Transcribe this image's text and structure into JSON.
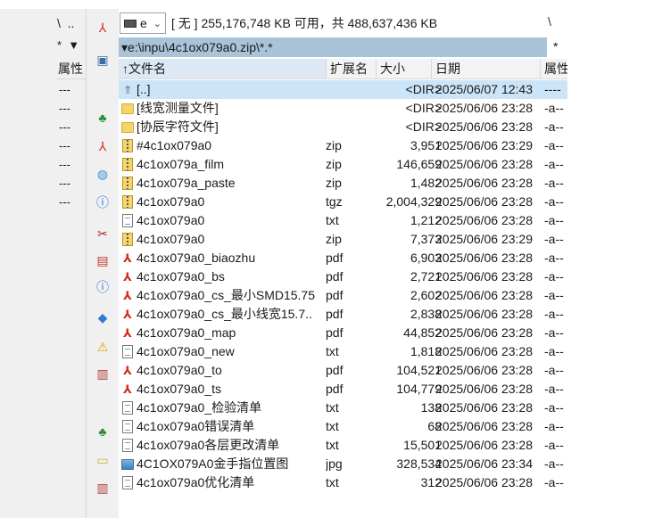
{
  "left_pane": {
    "toolbar_a": "\\  ..",
    "toolbar_b": "*  ▼",
    "header_attr": "属性",
    "rows": [
      "---",
      "---",
      "---",
      "---",
      "---",
      "---",
      "---"
    ]
  },
  "vbar_icons": [
    "pdf-icon",
    "network-drive-icon",
    "users-icon",
    "pdf-icon",
    "search-folder-icon",
    "info-icon",
    "cut-icon",
    "image-icon",
    "info-icon",
    "shield-icon",
    "warning-icon",
    "compare-icon",
    "users-icon",
    "folder-icon",
    "compare-icon"
  ],
  "drive": {
    "letter": "e",
    "free_text": "[ 无 ]  255,176,748 KB 可用，共 488,637,436 KB",
    "sep": "\\"
  },
  "path": {
    "value": "▾e:\\inpu\\4c1ox079a0.zip\\*.*",
    "star": "*"
  },
  "columns": {
    "name": "↑文件名",
    "ext": "扩展名",
    "size": "大小",
    "date": "日期",
    "attr": "属性"
  },
  "files": [
    {
      "icon": "up",
      "name": "[..]",
      "ext": "",
      "size": "<DIR>",
      "date": "2025/06/07 12:43",
      "attr": "----",
      "selected": true
    },
    {
      "icon": "folder",
      "name": "[线宽测量文件]",
      "ext": "",
      "size": "<DIR>",
      "date": "2025/06/06 23:28",
      "attr": "-a--"
    },
    {
      "icon": "folder",
      "name": "[协辰字符文件]",
      "ext": "",
      "size": "<DIR>",
      "date": "2025/06/06 23:28",
      "attr": "-a--"
    },
    {
      "icon": "zip",
      "name": "#4c1ox079a0",
      "ext": "zip",
      "size": "3,951",
      "date": "2025/06/06 23:29",
      "attr": "-a--"
    },
    {
      "icon": "zip",
      "name": "4c1ox079a_film",
      "ext": "zip",
      "size": "146,659",
      "date": "2025/06/06 23:28",
      "attr": "-a--"
    },
    {
      "icon": "zip",
      "name": "4c1ox079a_paste",
      "ext": "zip",
      "size": "1,482",
      "date": "2025/06/06 23:28",
      "attr": "-a--"
    },
    {
      "icon": "zip",
      "name": "4c1ox079a0",
      "ext": "tgz",
      "size": "2,004,329",
      "date": "2025/06/06 23:28",
      "attr": "-a--"
    },
    {
      "icon": "doc",
      "name": "4c1ox079a0",
      "ext": "txt",
      "size": "1,212",
      "date": "2025/06/06 23:28",
      "attr": "-a--"
    },
    {
      "icon": "zip",
      "name": "4c1ox079a0",
      "ext": "zip",
      "size": "7,373",
      "date": "2025/06/06 23:29",
      "attr": "-a--"
    },
    {
      "icon": "pdf",
      "name": "4c1ox079a0_biaozhu",
      "ext": "pdf",
      "size": "6,903",
      "date": "2025/06/06 23:28",
      "attr": "-a--"
    },
    {
      "icon": "pdf",
      "name": "4c1ox079a0_bs",
      "ext": "pdf",
      "size": "2,721",
      "date": "2025/06/06 23:28",
      "attr": "-a--"
    },
    {
      "icon": "pdf",
      "name": "4c1ox079a0_cs_最小SMD15.75",
      "ext": "pdf",
      "size": "2,602",
      "date": "2025/06/06 23:28",
      "attr": "-a--"
    },
    {
      "icon": "pdf",
      "name": "4c1ox079a0_cs_最小线宽15.7..",
      "ext": "pdf",
      "size": "2,838",
      "date": "2025/06/06 23:28",
      "attr": "-a--"
    },
    {
      "icon": "pdf",
      "name": "4c1ox079a0_map",
      "ext": "pdf",
      "size": "44,852",
      "date": "2025/06/06 23:28",
      "attr": "-a--"
    },
    {
      "icon": "doc",
      "name": "4c1ox079a0_new",
      "ext": "txt",
      "size": "1,818",
      "date": "2025/06/06 23:28",
      "attr": "-a--"
    },
    {
      "icon": "pdf",
      "name": "4c1ox079a0_to",
      "ext": "pdf",
      "size": "104,521",
      "date": "2025/06/06 23:28",
      "attr": "-a--"
    },
    {
      "icon": "pdf",
      "name": "4c1ox079a0_ts",
      "ext": "pdf",
      "size": "104,779",
      "date": "2025/06/06 23:28",
      "attr": "-a--"
    },
    {
      "icon": "doc",
      "name": "4c1ox079a0_检验清单",
      "ext": "txt",
      "size": "138",
      "date": "2025/06/06 23:28",
      "attr": "-a--"
    },
    {
      "icon": "doc",
      "name": "4c1ox079a0错误清单",
      "ext": "txt",
      "size": "68",
      "date": "2025/06/06 23:28",
      "attr": "-a--"
    },
    {
      "icon": "doc",
      "name": "4c1ox079a0各层更改清单",
      "ext": "txt",
      "size": "15,501",
      "date": "2025/06/06 23:28",
      "attr": "-a--"
    },
    {
      "icon": "img",
      "name": "4C1OX079A0金手指位置图",
      "ext": "jpg",
      "size": "328,534",
      "date": "2025/06/06 23:34",
      "attr": "-a--"
    },
    {
      "icon": "doc",
      "name": "4c1ox079a0优化清单",
      "ext": "txt",
      "size": "312",
      "date": "2025/06/06 23:28",
      "attr": "-a--"
    }
  ]
}
